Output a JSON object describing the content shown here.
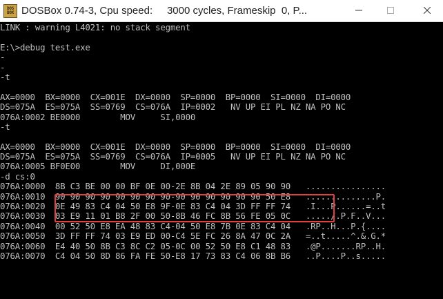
{
  "window": {
    "title": "DOSBox 0.74-3, Cpu speed:     3000 cycles, Frameskip  0, P...",
    "app_icon_text": "DOS BOX",
    "minimize_icon": "minimize-icon",
    "maximize_icon": "maximize-icon",
    "close_icon": "close-icon"
  },
  "console": {
    "lines": [
      "LINK : warning L4021: no stack segment",
      "",
      "E:\\>debug test.exe",
      "-",
      "-",
      "-t",
      "",
      "AX=0000  BX=0000  CX=001E  DX=0000  SP=0000  BP=0000  SI=0000  DI=0000",
      "DS=075A  ES=075A  SS=0769  CS=076A  IP=0002   NV UP EI PL NZ NA PO NC",
      "076A:0002 BE0000        MOV     SI,0000",
      "-t",
      "",
      "AX=0000  BX=0000  CX=001E  DX=0000  SP=0000  BP=0000  SI=0000  DI=0000",
      "DS=075A  ES=075A  SS=0769  CS=076A  IP=0005   NV UP EI PL NZ NA PO NC",
      "076A:0005 BF0E00        MOV     DI,000E",
      "-d cs:0",
      "076A:0000  8B C3 BE 00 00 BF 0E 00-2E 8B 04 2E 89 05 90 90   ................",
      "076A:0010  90 90 90 90 90 90 90 90-90 90 90 90 90 90 50 E8   ..............P.",
      "076A:0020  0E 49 83 C4 04 50 E8 9F-0E 83 C4 04 3D FF FF 74   .I...P......=..t",
      "076A:0030  03 E9 11 01 B8 2F 00 50-8B 46 FC 8B 56 FE 05 0C   ...../.P.F..V...",
      "076A:0040  00 52 50 E8 EA 48 83 C4-04 50 E8 7B 0E 83 C4 04   .RP..H...P.{....",
      "076A:0050  3D FF FF 74 03 E9 ED 00-C4 5E FC 26 8A 47 0C 2A   =..t.....^.&.G.*",
      "076A:0060  E4 40 50 8B C3 8C C2 05-0C 00 52 50 E8 C1 48 83   .@P.......RP..H.",
      "076A:0070  C4 04 50 8D 86 FA FE 50-E8 17 73 83 C4 06 8B B6   ..P....P..s....."
    ]
  }
}
